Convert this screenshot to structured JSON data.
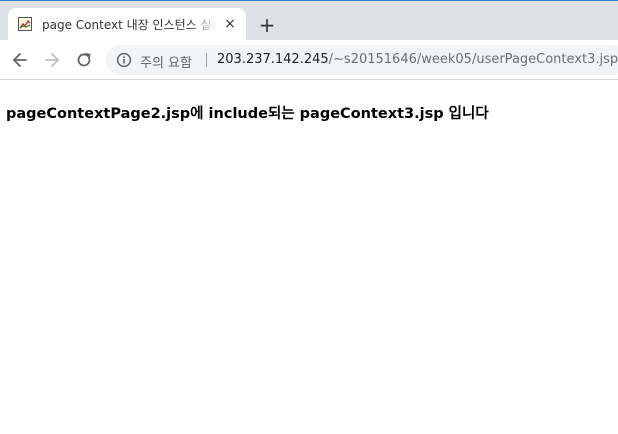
{
  "tab": {
    "title": "page Context 내장 인스턴스 실습",
    "favicon_icon": "jsp-page-icon",
    "close_icon": "×"
  },
  "newtab_icon": "+",
  "toolbar": {
    "back_icon": "back-arrow",
    "forward_icon": "forward-arrow",
    "reload_icon": "reload",
    "security_label": "주의 요함",
    "url_host": "203.237.142.245",
    "url_path": "/~s20151646/week05/userPageContext3.jsp"
  },
  "page": {
    "message": "pageContextPage2.jsp에 include되는 pageContext3.jsp 입니다"
  },
  "colors": {
    "tabstrip_bg": "#dee1e6",
    "omnibox_bg": "#f1f3f4",
    "text": "#000000"
  }
}
